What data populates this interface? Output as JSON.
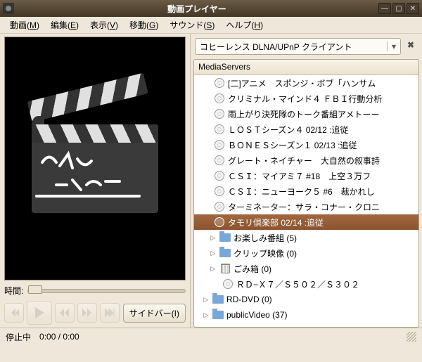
{
  "window": {
    "title": "動画プレイヤー"
  },
  "menu": {
    "video": {
      "pre": "動画(",
      "key": "M",
      "post": ")"
    },
    "edit": {
      "pre": "編集(",
      "key": "E",
      "post": ")"
    },
    "view": {
      "pre": "表示(",
      "key": "V",
      "post": ")"
    },
    "go": {
      "pre": "移動(",
      "key": "G",
      "post": ")"
    },
    "sound": {
      "pre": "サウンド(",
      "key": "S",
      "post": ")"
    },
    "help": {
      "pre": "ヘルプ(",
      "key": "H",
      "post": ")"
    }
  },
  "left": {
    "time_label": "時間:",
    "sidebar_btn": {
      "pre": "サイドバー(",
      "key": "I",
      "post": ")"
    }
  },
  "combo": {
    "selected": "コヒーレンス DLNA/UPnP クライアント"
  },
  "tree": {
    "header": "MediaServers",
    "items": [
      {
        "type": "disc",
        "label": "[二]アニメ　スポンジ・ボブ「ハンサム"
      },
      {
        "type": "disc",
        "label": "クリミナル・マインド４ ＦＢＩ行動分析"
      },
      {
        "type": "disc",
        "label": "雨上がり決死隊のトーク番組アメトーー"
      },
      {
        "type": "disc",
        "label": "ＬＯＳＴシーズン４ 02/12 :追従"
      },
      {
        "type": "disc",
        "label": "ＢＯＮＥＳシーズン１ 02/13 :追従"
      },
      {
        "type": "disc",
        "label": "グレート・ネイチャー　大自然の叙事詩"
      },
      {
        "type": "disc",
        "label": "ＣＳＩ：マイアミ７ #18　上空３万フ"
      },
      {
        "type": "disc",
        "label": "ＣＳＩ：ニューヨーク５ #6　裁かれし"
      },
      {
        "type": "disc",
        "label": "ターミネーター：サラ・コナー・クロニ"
      },
      {
        "type": "disc",
        "label": "タモリ倶楽部 02/14 :追従",
        "selected": true
      },
      {
        "type": "folder",
        "label": "お楽しみ番組 (5)"
      },
      {
        "type": "folder",
        "label": "クリップ映像 (0)"
      },
      {
        "type": "trash",
        "label": "ごみ箱 (0)"
      },
      {
        "type": "disc",
        "label": "ＲＤ−Ｘ７／Ｓ５０２／Ｓ３０２",
        "indent": true
      },
      {
        "type": "folder",
        "label": "RD-DVD (0)",
        "outdent": true
      },
      {
        "type": "folder",
        "label": "publicVideo (37)",
        "outdent": true
      }
    ]
  },
  "status": {
    "state": "停止中",
    "time": "0:00 / 0:00"
  }
}
